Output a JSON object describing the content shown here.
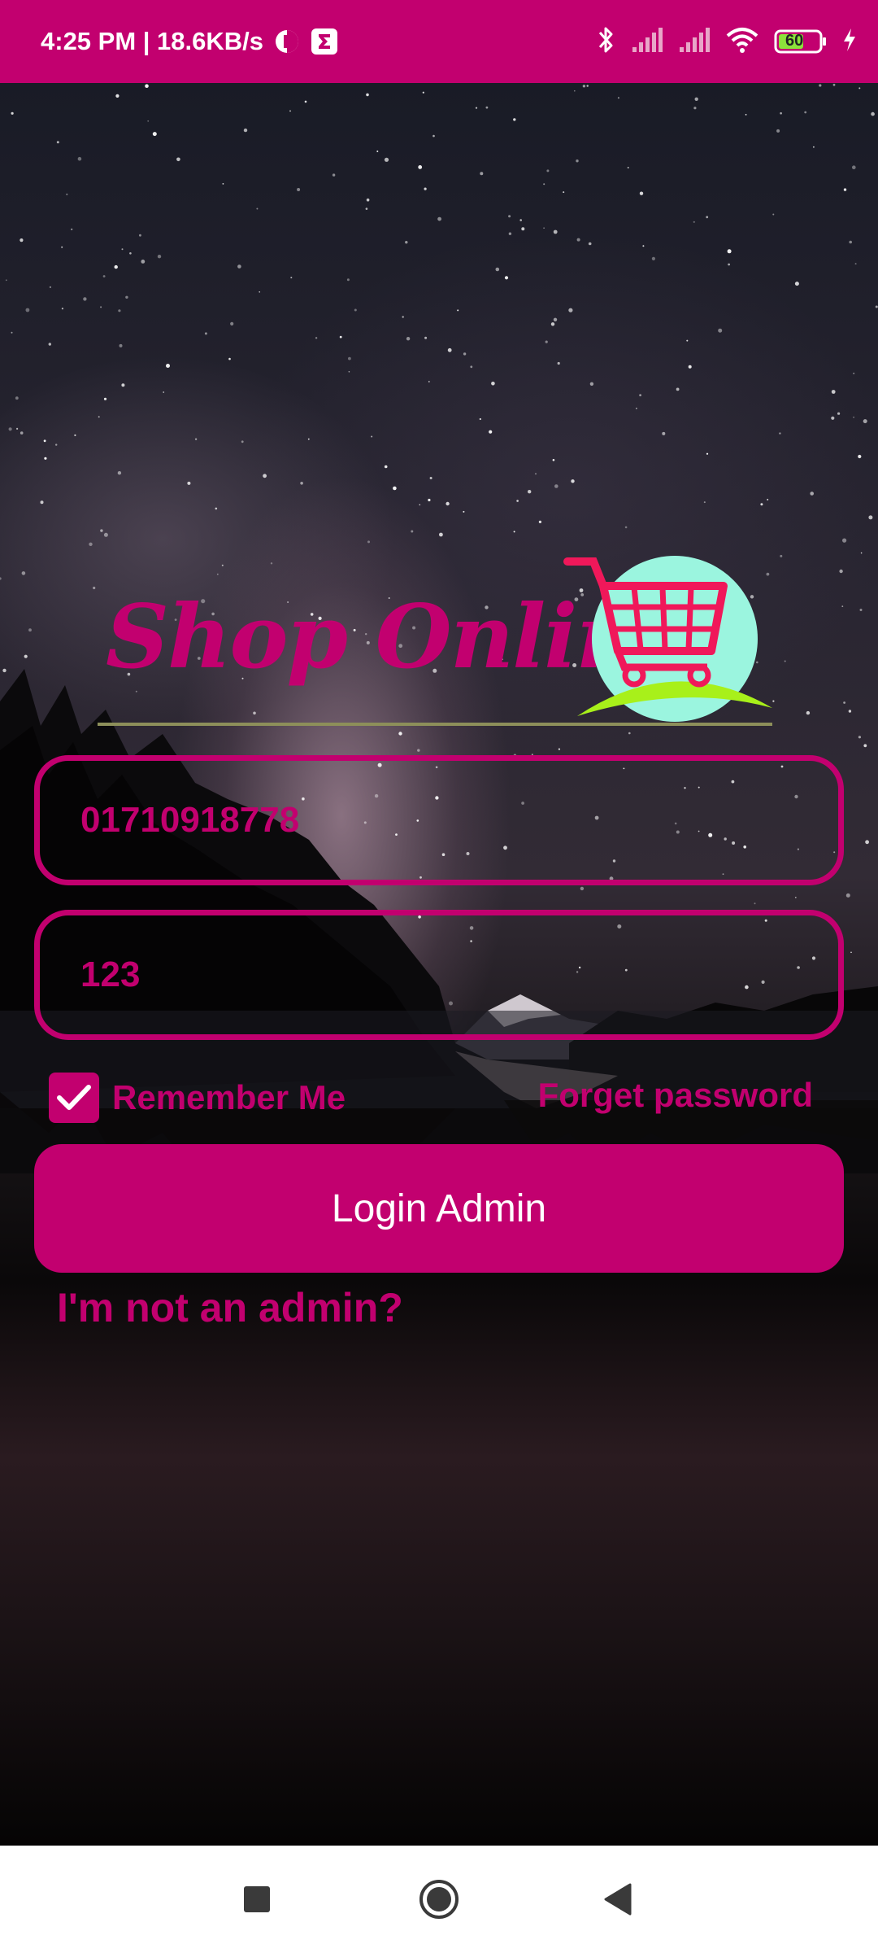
{
  "status_bar": {
    "time_speed": "4:25 PM | 18.6KB/s",
    "battery_level": "60",
    "icons": [
      "data-saver-icon",
      "sigma-app-icon",
      "bluetooth-icon",
      "signal-icon",
      "signal-icon",
      "wifi-icon",
      "battery-icon",
      "charging-icon"
    ]
  },
  "logo": {
    "text": "Shop Online",
    "icon": "shopping-cart-icon",
    "colors": {
      "brand": "#C2006F",
      "circle": "#9BF5DF",
      "hill": "#A8F01A",
      "cart": "#F0185A"
    }
  },
  "form": {
    "phone_value": "01710918778",
    "password_value": "123",
    "remember_label": "Remember Me",
    "remember_checked": true,
    "forget_label": "Forget password",
    "login_label": "Login Admin",
    "not_admin_label": "I'm not an admin?"
  },
  "nav": {
    "icons": [
      "recents-square-icon",
      "home-circle-icon",
      "back-triangle-icon"
    ]
  },
  "colors": {
    "accent": "#C2006F",
    "nav_background": "#FFFFFF"
  }
}
